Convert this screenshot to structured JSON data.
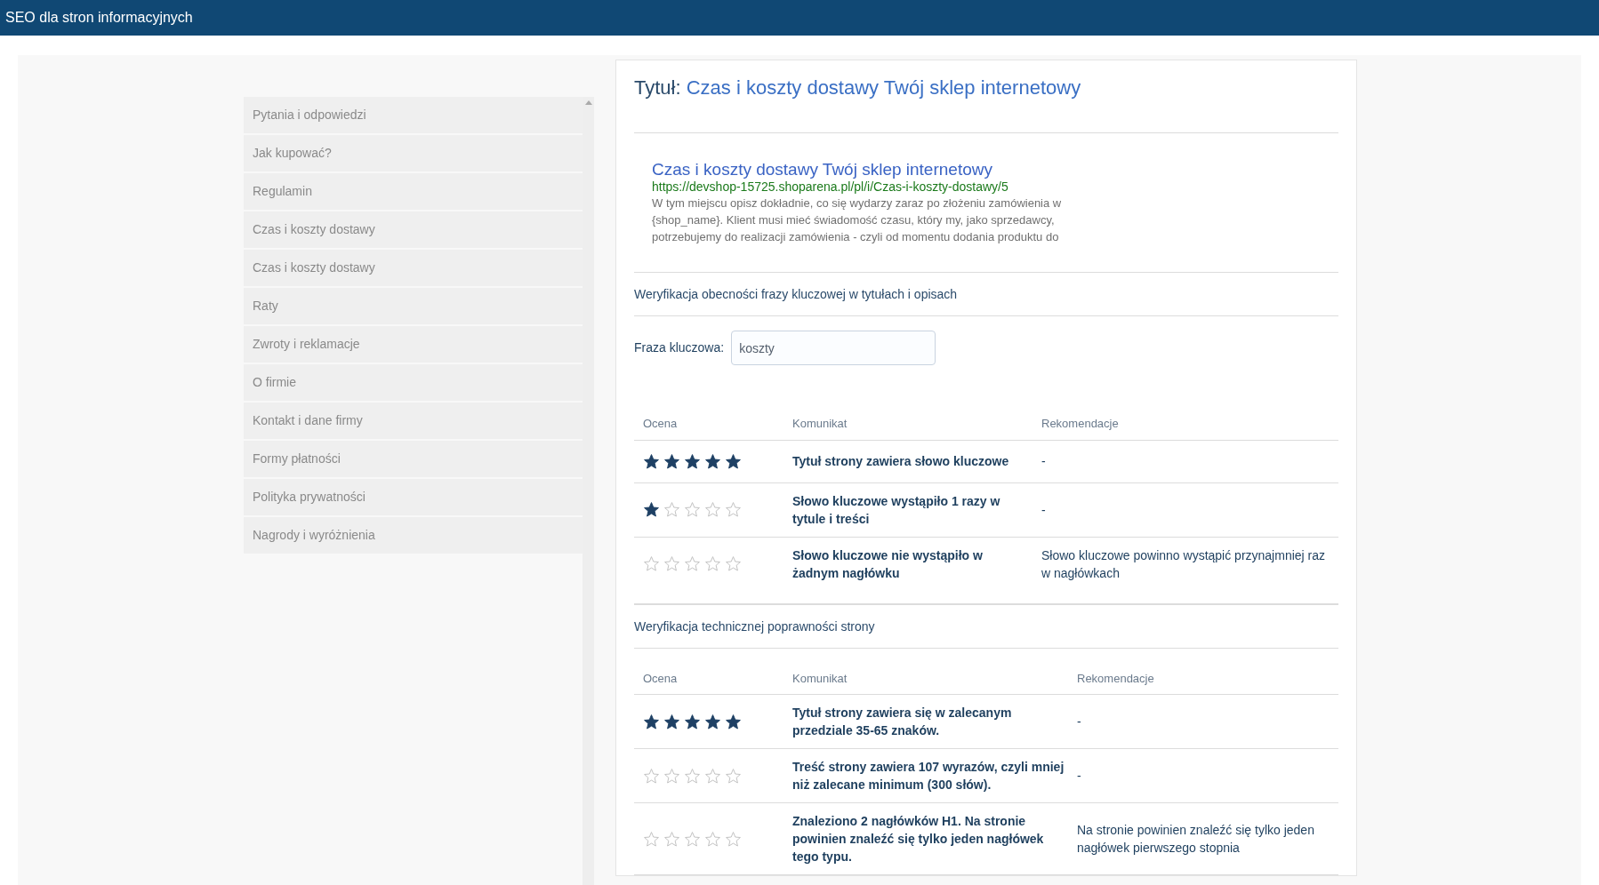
{
  "header": {
    "title": "SEO dla stron informacyjnych"
  },
  "sidebar": {
    "items": [
      {
        "label": "Pytania i odpowiedzi"
      },
      {
        "label": "Jak kupować?"
      },
      {
        "label": "Regulamin"
      },
      {
        "label": "Czas i koszty dostawy"
      },
      {
        "label": "Czas i koszty dostawy"
      },
      {
        "label": "Raty"
      },
      {
        "label": "Zwroty i reklamacje"
      },
      {
        "label": "O firmie"
      },
      {
        "label": "Kontakt i dane firmy"
      },
      {
        "label": "Formy płatności"
      },
      {
        "label": "Polityka prywatności"
      },
      {
        "label": "Nagrody i wyróżnienia"
      }
    ]
  },
  "main": {
    "title_label": "Tytuł:",
    "title_value": "Czas i koszty dostawy Twój sklep internetowy",
    "snippet": {
      "title": "Czas i koszty dostawy Twój sklep internetowy",
      "url": "https://devshop-15725.shoparena.pl/pl/i/Czas-i-koszty-dostawy/5",
      "description": "W tym miejscu opisz dokładnie, co się wydarzy zaraz po złożeniu zamówienia w {shop_name}. Klient musi mieć świadomość czasu, który my, jako sprzedawcy, potrzebujemy do realizacji zamówienia - czyli od momentu dodania produktu do"
    },
    "sections": [
      {
        "heading": "Weryfikacja obecności frazy kluczowej w tytułach i opisach",
        "keyword_field": {
          "label": "Fraza kluczowa:",
          "value": "koszty"
        },
        "columns": [
          "Ocena",
          "Komunikat",
          "Rekomendacje"
        ],
        "rows": [
          {
            "stars": 5,
            "message": "Tytuł strony zawiera słowo kluczowe",
            "recommendation": "-"
          },
          {
            "stars": 1,
            "message": "Słowo kluczowe wystąpiło 1 razy w tytule i treści",
            "recommendation": "-"
          },
          {
            "stars": 0,
            "message": "Słowo kluczowe nie wystąpiło w żadnym nagłówku",
            "recommendation": "Słowo kluczowe powinno wystąpić przynajmniej raz w nagłówkach"
          }
        ]
      },
      {
        "heading": "Weryfikacja technicznej poprawności strony",
        "columns": [
          "Ocena",
          "Komunikat",
          "Rekomendacje"
        ],
        "rows": [
          {
            "stars": 5,
            "message": "Tytuł strony zawiera się w zalecanym przedziale 35-65 znaków.",
            "recommendation": "-"
          },
          {
            "stars": 0,
            "message": "Treść strony zawiera 107 wyrazów, czyli mniej niż zalecane minimum (300 słów).",
            "recommendation": "-"
          },
          {
            "stars": 0,
            "message": "Znaleziono 2 nagłówków H1. Na stronie powinien znaleźć się tylko jeden nagłówek tego typu.",
            "recommendation": "Na stronie powinien znaleźć się tylko jeden nagłówek pierwszego stopnia"
          }
        ]
      }
    ]
  }
}
